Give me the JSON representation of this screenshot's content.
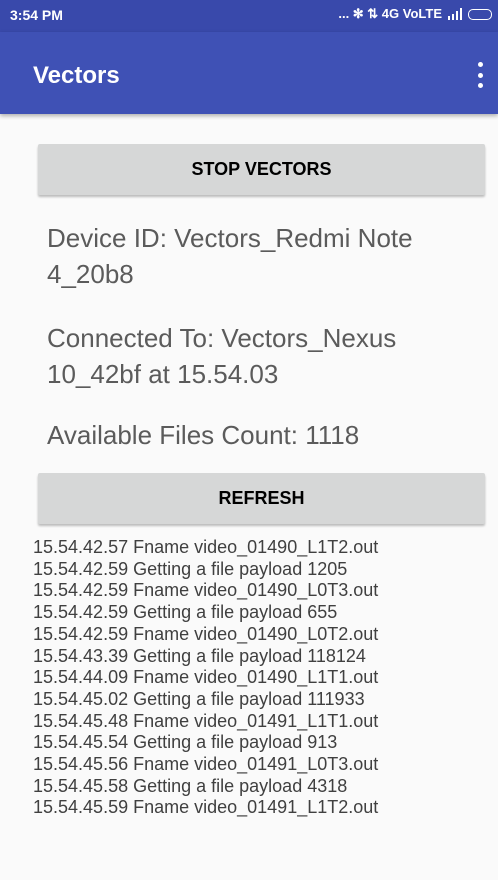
{
  "status_bar": {
    "time": "3:54 PM",
    "right_text": "... ✻ ⇅ 4G VoLTE"
  },
  "app_bar": {
    "title": "Vectors"
  },
  "main": {
    "stop_button_label": "STOP VECTORS",
    "device_id": "Device ID: Vectors_Redmi Note 4_20b8",
    "connected_to": "Connected To: Vectors_Nexus 10_42bf at 15.54.03",
    "files_count": "Available Files Count: 1118",
    "refresh_button_label": "REFRESH"
  },
  "log": [
    "15.54.42.57 Fname video_01490_L1T2.out",
    "15.54.42.59 Getting a file payload 1205",
    "15.54.42.59 Fname video_01490_L0T3.out",
    "15.54.42.59 Getting a file payload 655",
    "15.54.42.59 Fname video_01490_L0T2.out",
    "15.54.43.39 Getting a file payload 118124",
    "15.54.44.09 Fname video_01490_L1T1.out",
    "15.54.45.02 Getting a file payload 111933",
    "15.54.45.48 Fname video_01491_L1T1.out",
    "15.54.45.54 Getting a file payload 913",
    "15.54.45.56 Fname video_01491_L0T3.out",
    "15.54.45.58 Getting a file payload 4318",
    "15.54.45.59 Fname video_01491_L1T2.out"
  ]
}
